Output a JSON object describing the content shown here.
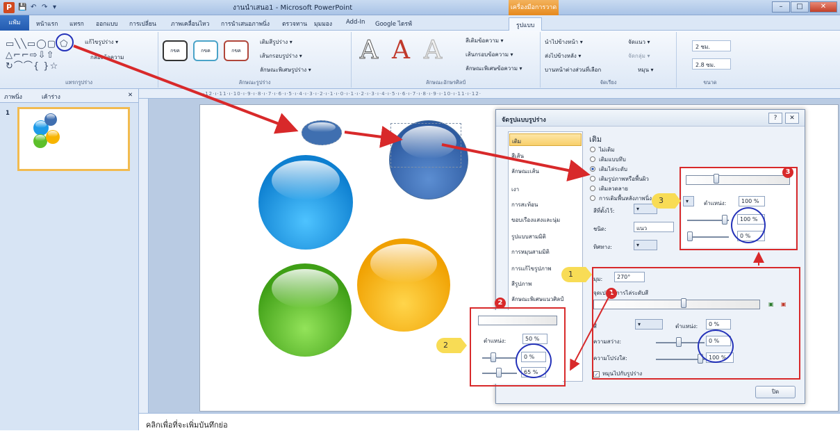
{
  "window": {
    "title": "งานนำเสนอ1 - Microsoft PowerPoint",
    "tools_tab": "เครื่องมือการวาด",
    "min": "–",
    "max": "□",
    "close": "✕"
  },
  "app_icon": "P",
  "quick_access": [
    "💾",
    "↶",
    "↷",
    "▾"
  ],
  "tabs": [
    "แฟ้ม",
    "หน้าแรก",
    "แทรก",
    "ออกแบบ",
    "การเปลี่ยน",
    "ภาพเคลื่อนไหว",
    "การนำเสนอภาพนิ่ง",
    "ตรวจทาน",
    "มุมมอง",
    "Add-In",
    "Google ไดรฟ์",
    "รูปแบบ"
  ],
  "ribbon": {
    "insert_shapes": {
      "label": "แทรกรูปร่าง",
      "edit_shape": "แก้ไขรูปร่าง ▾",
      "text_box": "กล่องข้อความ",
      "shapes_row1": "▭╲╲▭◯▢ ⬠",
      "shapes_row2": "△⌐⌐⇨⇩⇧ ",
      "shapes_row3": "↻⌒⌒{ }☆ "
    },
    "shape_styles": {
      "label": "ลักษณะรูปร่าง",
      "fill": "เติมสีรูปร่าง ▾",
      "outline": "เส้นกรอบรูปร่าง ▾",
      "effects": "ลักษณะพิเศษรูปร่าง ▾",
      "sample": "กขค"
    },
    "wordart": {
      "label": "ลักษณะอักษรศิลป์",
      "text_fill": "สีเติมข้อความ ▾",
      "text_outline": "เส้นกรอบข้อความ ▾",
      "text_effects": "ลักษณะพิเศษข้อความ ▾",
      "letter": "A"
    },
    "arrange": {
      "label": "จัดเรียง",
      "bring_forward": "นำไปข้างหน้า ▾",
      "send_backward": "ส่งไปข้างหลัง ▾",
      "selection_pane": "บานหน้าต่างส่วนที่เลือก",
      "align": "จัดแนว ▾",
      "group": "จัดกลุ่ม ▾",
      "rotate": "หมุน ▾"
    },
    "size": {
      "label": "ขนาด",
      "height": "2 ซม.",
      "width": "2.8 ซม."
    }
  },
  "left_panel": {
    "tab_slides": "ภาพนิ่ง",
    "tab_outline": "เค้าร่าง",
    "close": "✕",
    "slide_number": "1"
  },
  "ruler_text": "·12·ı·11·ı·10·ı·9·ı·8·ı·7·ı·6·ı·5·ı·4·ı·3·ı·2·ı·1·ı·0·ı·1·ı·2·ı·3·ı·4·ı·5·ı·6·ı·7·ı·8·ı·9·ı·10·ı·11·ı·12·",
  "notes_placeholder": "คลิกเพื่อที่จะเพิ่มบันทึกย่อ",
  "colors": {
    "blue": "#1e9be8",
    "green": "#5cbf2a",
    "yellow": "#f7b400",
    "selected": "#3f6fb0",
    "highlight_red": "#d8292a",
    "callout": "#f8dc55"
  },
  "dialog": {
    "title": "จัดรูปแบบรูปร่าง",
    "help": "?",
    "close": "✕",
    "nav": [
      "เติม",
      "สีเส้น",
      "ลักษณะเส้น",
      "เงา",
      "การสะท้อน",
      "ขอบเรืองแสงและนุ่ม",
      "รูปแบบสามมิติ",
      "การหมุนสามมิติ",
      "การแก้ไขรูปภาพ",
      "สีรูปภาพ",
      "ลักษณะพิเศษแนวศิลป์"
    ],
    "section_title": "เติม",
    "fill_options": [
      "ไม่เติม",
      "เติมแบบทึบ",
      "เติมไล่ระดับ",
      "เติมรูปภาพหรือพื้นผิว",
      "เติมลวดลาย",
      "การเติมพื้นหลังภาพนิ่ง"
    ],
    "preset_colors_label": "สีที่ตั้งไว้:",
    "type_label": "ชนิด:",
    "type_value": "แนว",
    "direction_label": "ทิศทาง:",
    "angle_label": "มุม:",
    "angle_value": "270°",
    "stops_label": "จุดเปลี่ยนการไล่ระดับสี",
    "color_label": "สี",
    "position_label": "ตำแหน่ง:",
    "position_value": "0 %",
    "brightness_label": "ความสว่าง:",
    "brightness_value": "0 %",
    "transparency_label": "ความโปร่งใส:",
    "transparency_value": "100 %",
    "rotate_with_shape": "หมุนไปกับรูปร่าง",
    "close_button": "ปิด"
  },
  "inset2": {
    "position_label": "ตำแหน่ง:",
    "position_value": "50 %",
    "brightness_value": "0 %",
    "transparency_value": "65 %"
  },
  "inset3": {
    "position_label": "ตำแหน่ง:",
    "position_value": "100 %",
    "brightness_value": "100 %",
    "transparency_value": "0 %"
  },
  "badges": [
    "1",
    "2",
    "3"
  ],
  "callouts": [
    "1",
    "2",
    "3"
  ]
}
